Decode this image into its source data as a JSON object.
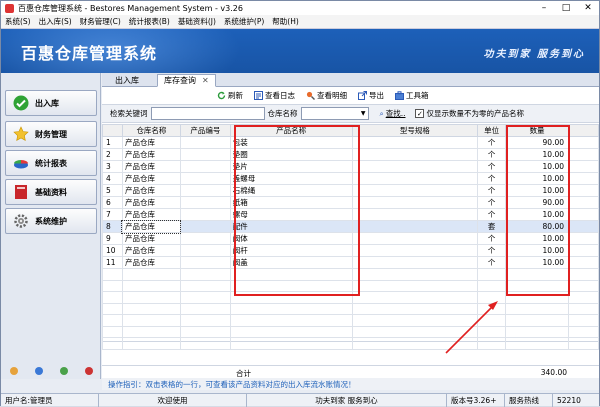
{
  "window": {
    "title": "百惠仓库管理系统 - Bestores Management System - v3.26"
  },
  "menu": [
    "系统(S)",
    "出入库(S)",
    "财务管理(C)",
    "统计报表(B)",
    "基础资料(J)",
    "系统维护(P)",
    "帮助(H)"
  ],
  "banner": {
    "app_name": "百惠仓库管理系统",
    "slogan": "功夫到家 服务到心"
  },
  "sidebar": {
    "items": [
      {
        "label": "出入库",
        "icon": "check-icon"
      },
      {
        "label": "财务管理",
        "icon": "star-icon"
      },
      {
        "label": "统计报表",
        "icon": "pie-chart-icon"
      },
      {
        "label": "基础资料",
        "icon": "book-icon"
      },
      {
        "label": "系统维护",
        "icon": "gear-icon"
      }
    ]
  },
  "tabs": [
    {
      "label": "出入库"
    },
    {
      "label": "库存查询",
      "active": true
    }
  ],
  "toolbar": {
    "refresh": "刷新",
    "view_log": "查看日志",
    "view_detail": "查看明细",
    "export": "导出",
    "toolbox": "工具箱"
  },
  "filter": {
    "keyword_label": "检索关键词",
    "keyword_value": "",
    "warehouse_label": "仓库名称",
    "warehouse_value": "",
    "search_button": "查找..",
    "nonzero_label": "仅显示数量不为零的产品名称",
    "nonzero_checked": true
  },
  "table": {
    "columns": [
      "仓库名称",
      "产品编号",
      "产品名称",
      "型号规格",
      "单位",
      "数量"
    ],
    "rows": [
      [
        "1",
        "产品仓库",
        "",
        "包装",
        "",
        "个",
        "90.00"
      ],
      [
        "2",
        "产品仓库",
        "",
        "垫圈",
        "",
        "个",
        "10.00"
      ],
      [
        "3",
        "产品仓库",
        "",
        "垫片",
        "",
        "个",
        "10.00"
      ],
      [
        "4",
        "产品仓库",
        "",
        "盖螺母",
        "",
        "个",
        "10.00"
      ],
      [
        "5",
        "产品仓库",
        "",
        "石棉绳",
        "",
        "个",
        "10.00"
      ],
      [
        "6",
        "产品仓库",
        "",
        "纸箱",
        "",
        "个",
        "90.00"
      ],
      [
        "7",
        "产品仓库",
        "",
        "螺母",
        "",
        "个",
        "10.00"
      ],
      [
        "8",
        "产品仓库",
        "",
        "配件",
        "",
        "套",
        "80.00"
      ],
      [
        "9",
        "产品仓库",
        "",
        "阀体",
        "",
        "个",
        "10.00"
      ],
      [
        "10",
        "产品仓库",
        "",
        "阀杆",
        "",
        "个",
        "10.00"
      ],
      [
        "11",
        "产品仓库",
        "",
        "阀盖",
        "",
        "个",
        "10.00"
      ]
    ],
    "selected_row": 8,
    "total_label": "合计",
    "total_value": "340.00"
  },
  "guide": "操作指引：双击表格的一行，可查看该产品资料对应的出入库流水账情况！",
  "status": {
    "user": "用户名:管理员",
    "welcome": "欢迎使用",
    "slogan": "功夫到家 服务到心",
    "version": "版本号3.26+",
    "service": "服务热线",
    "code": "52210"
  },
  "colors": {
    "banner": "#1d60b9",
    "highlight_box": "#e02020",
    "selected_row": "#dbe6f7"
  }
}
